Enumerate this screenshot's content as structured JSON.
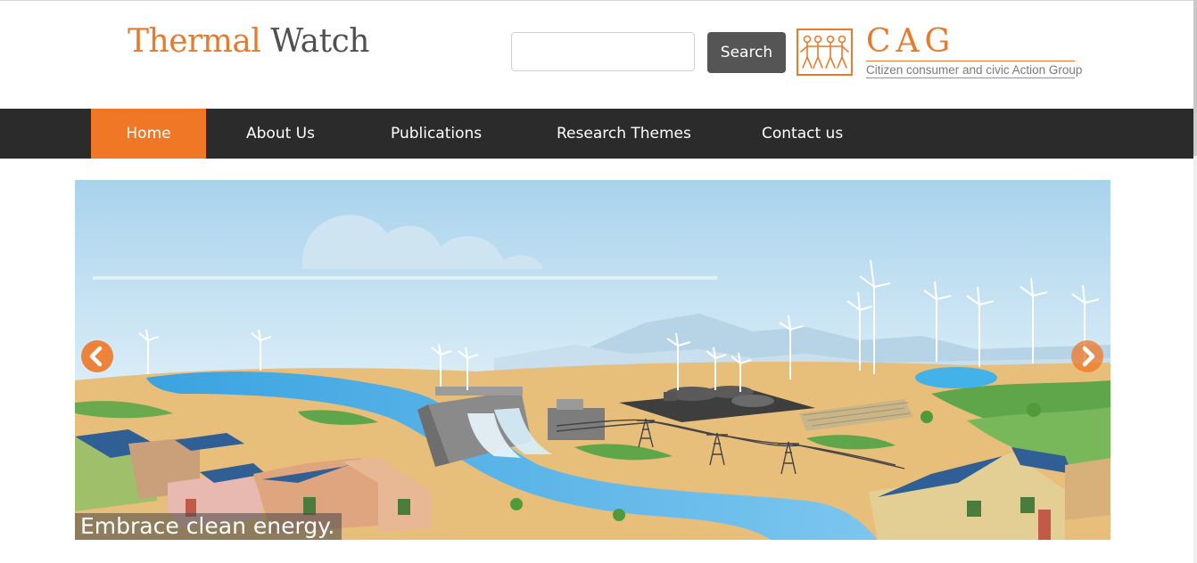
{
  "header": {
    "logo_word1": "Thermal",
    "logo_word2": "Watch",
    "search": {
      "value": "",
      "placeholder": "",
      "button_label": "Search"
    },
    "partner": {
      "title": "CAG",
      "subtitle": "Citizen consumer and civic Action Group"
    }
  },
  "nav": {
    "items": [
      {
        "label": "Home",
        "active": true
      },
      {
        "label": "About Us",
        "active": false
      },
      {
        "label": "Publications",
        "active": false
      },
      {
        "label": "Research Themes",
        "active": false
      },
      {
        "label": "Contact us",
        "active": false
      }
    ]
  },
  "slider": {
    "caption": "Embrace clean energy.",
    "prev_icon": "chevron-left-icon",
    "next_icon": "chevron-right-icon"
  },
  "colors": {
    "accent": "#f07726",
    "nav_bg": "#2b2b2b",
    "button_bg": "#555555"
  }
}
